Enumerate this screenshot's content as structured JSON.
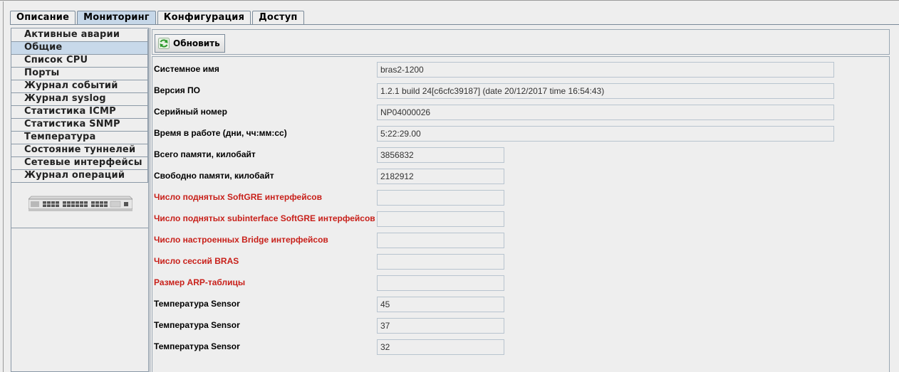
{
  "tabs": [
    {
      "label": "Описание",
      "active": false
    },
    {
      "label": "Мониторинг",
      "active": true
    },
    {
      "label": "Конфигурация",
      "active": false
    },
    {
      "label": "Доступ",
      "active": false
    }
  ],
  "sidebar": {
    "selected_index": 1,
    "items": [
      {
        "label": "Активные аварии"
      },
      {
        "label": "Общие"
      },
      {
        "label": "Список CPU"
      },
      {
        "label": "Порты"
      },
      {
        "label": "Журнал событий"
      },
      {
        "label": "Журнал syslog"
      },
      {
        "label": "Статистика ICMP"
      },
      {
        "label": "Статистика SNMP"
      },
      {
        "label": "Температура"
      },
      {
        "label": "Состояние туннелей"
      },
      {
        "label": "Сетевые интерфейсы"
      },
      {
        "label": "Журнал операций"
      }
    ],
    "device_image": "network-switch-device-image"
  },
  "toolbar": {
    "refresh_label": "Обновить",
    "refresh_icon": "refresh-icon"
  },
  "colors": {
    "warning_label": "#c8201a",
    "selected_bg": "#c8d9ea",
    "active_tab_bg": "#c6d7e8"
  },
  "fields": [
    {
      "label": "Системное имя",
      "value": "bras2-1200",
      "warning": false,
      "wide": true
    },
    {
      "label": "Версия ПО",
      "value": "1.2.1 build 24[c6cfc39187] (date 20/12/2017 time 16:54:43)",
      "warning": false,
      "wide": true
    },
    {
      "label": "Серийный номер",
      "value": "NP04000026",
      "warning": false,
      "wide": true
    },
    {
      "label": "Время в работе (дни, чч:мм:сс)",
      "value": "5:22:29.00",
      "warning": false,
      "wide": true
    },
    {
      "label": "Всего памяти, килобайт",
      "value": "3856832",
      "warning": false,
      "wide": false
    },
    {
      "label": "Свободно памяти, килобайт",
      "value": "2182912",
      "warning": false,
      "wide": false
    },
    {
      "label": "Число поднятых SoftGRE интерфейсов",
      "value": "",
      "warning": true,
      "wide": false
    },
    {
      "label": "Число поднятых subinterface SoftGRE интерфейсов",
      "value": "",
      "warning": true,
      "wide": false
    },
    {
      "label": "Число настроенных Bridge интерфейсов",
      "value": "",
      "warning": true,
      "wide": false
    },
    {
      "label": "Число сессий BRAS",
      "value": "",
      "warning": true,
      "wide": false
    },
    {
      "label": "Размер ARP-таблицы",
      "value": "",
      "warning": true,
      "wide": false
    },
    {
      "label": "Температура Sensor",
      "value": "45",
      "warning": false,
      "wide": false
    },
    {
      "label": "Температура Sensor",
      "value": "37",
      "warning": false,
      "wide": false
    },
    {
      "label": "Температура Sensor",
      "value": "32",
      "warning": false,
      "wide": false
    }
  ]
}
